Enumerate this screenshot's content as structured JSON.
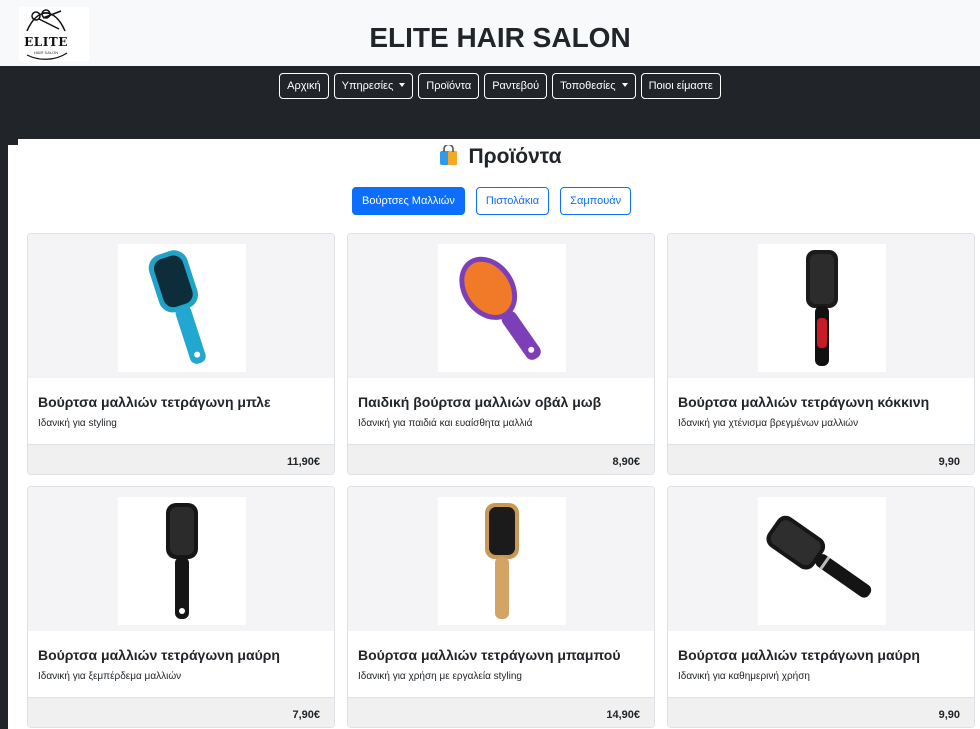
{
  "header": {
    "logo_text": "ELITE",
    "logo_subtext": "HAIR SALON",
    "title": "ELITE HAIR SALON"
  },
  "nav": {
    "items": [
      {
        "label": "Αρχική",
        "dropdown": false
      },
      {
        "label": "Υπηρεσίες",
        "dropdown": true
      },
      {
        "label": "Προϊόντα",
        "dropdown": false
      },
      {
        "label": "Ραντεβού",
        "dropdown": false
      },
      {
        "label": "Τοποθεσίες",
        "dropdown": true
      },
      {
        "label": "Ποιοι είμαστε",
        "dropdown": false
      }
    ]
  },
  "page": {
    "heading": "Προϊόντα",
    "heading_icon": "shopping-bag-icon"
  },
  "filters": {
    "items": [
      {
        "label": "Βούρτσες Μαλλιών",
        "active": true
      },
      {
        "label": "Πιστολάκια",
        "active": false
      },
      {
        "label": "Σαμπουάν",
        "active": false
      }
    ]
  },
  "products": [
    {
      "title": "Βούρτσα μαλλιών τετράγωνη μπλε",
      "description": "Ιδανική για styling",
      "price": "11,90€",
      "image": "blue-paddle-brush-icon"
    },
    {
      "title": "Παιδική βούρτσα μαλλιών οβάλ μωβ",
      "description": "Ιδανική για παιδιά και ευαίσθητα μαλλιά",
      "price": "8,90€",
      "image": "purple-oval-brush-icon"
    },
    {
      "title": "Βούρτσα μαλλιών τετράγωνη κόκκινη",
      "description": "Ιδανική για χτένισμα βρεγμένων μαλλιών",
      "price": "9,90",
      "image": "red-paddle-brush-icon"
    },
    {
      "title": "Βούρτσα μαλλιών τετράγωνη μαύρη",
      "description": "Ιδανική για ξεμπέρδεμα μαλλιών",
      "price": "7,90€",
      "image": "black-paddle-brush-icon"
    },
    {
      "title": "Βούρτσα μαλλιών τετράγωνη μπαμπού",
      "description": "Ιδανική για χρήση με εργαλεία styling",
      "price": "14,90€",
      "image": "bamboo-paddle-brush-icon"
    },
    {
      "title": "Βούρτσα μαλλιών τετράγωνη μαύρη",
      "description": "Ιδανική για καθημερινή χρήση",
      "price": "9,90",
      "image": "black-tilted-brush-icon"
    }
  ],
  "colors": {
    "navbar": "#212529",
    "primary": "#0d6efd",
    "header_bg": "#f8f9fa"
  }
}
